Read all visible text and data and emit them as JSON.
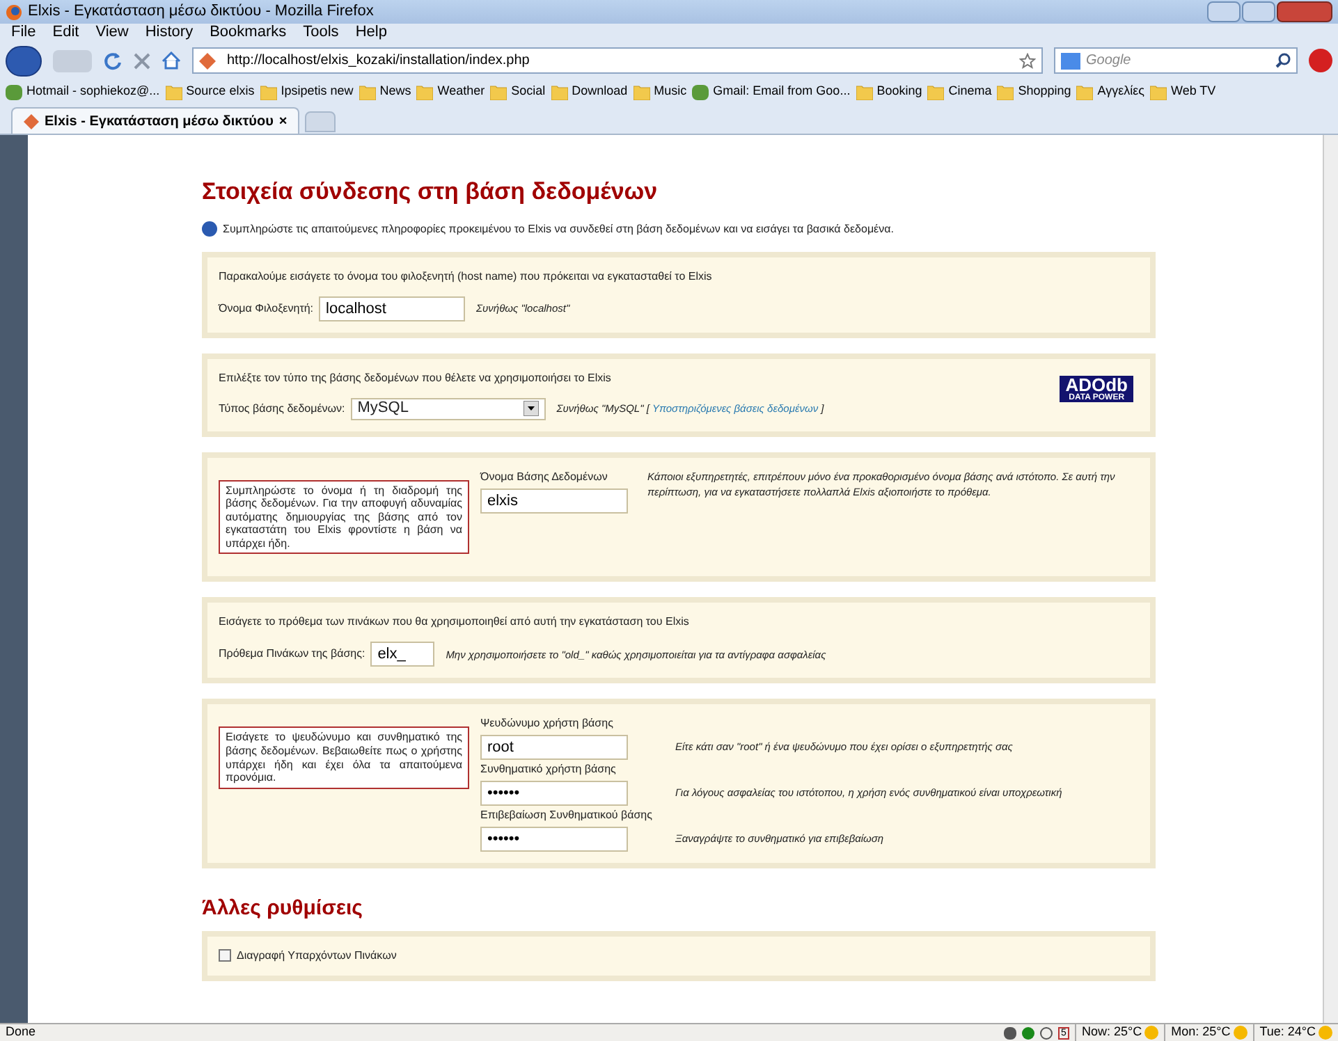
{
  "window": {
    "title": "Elxis - Εγκατάσταση μέσω δικτύου - Mozilla Firefox"
  },
  "menu": [
    "File",
    "Edit",
    "View",
    "History",
    "Bookmarks",
    "Tools",
    "Help"
  ],
  "address": {
    "url": "http://localhost/elxis_kozaki/installation/index.php"
  },
  "search": {
    "placeholder": "Google"
  },
  "bookmarks": [
    {
      "label": "Hotmail - sophiekoz@...",
      "kind": "site"
    },
    {
      "label": "Source elxis",
      "kind": "folder"
    },
    {
      "label": "Ipsipetis new",
      "kind": "folder"
    },
    {
      "label": "News",
      "kind": "folder"
    },
    {
      "label": "Weather",
      "kind": "folder"
    },
    {
      "label": "Social",
      "kind": "folder"
    },
    {
      "label": "Download",
      "kind": "folder"
    },
    {
      "label": "Music",
      "kind": "folder"
    },
    {
      "label": "Gmail: Email from Goo...",
      "kind": "site"
    },
    {
      "label": "Booking",
      "kind": "folder"
    },
    {
      "label": "Cinema",
      "kind": "folder"
    },
    {
      "label": "Shopping",
      "kind": "folder"
    },
    {
      "label": "Αγγελίες",
      "kind": "folder"
    },
    {
      "label": "Web TV",
      "kind": "folder"
    }
  ],
  "tabs": [
    {
      "label": "Elxis - Εγκατάσταση μέσω δικτύου",
      "close": "×",
      "selected": true
    }
  ],
  "page": {
    "heading": "Στοιχεία σύνδεσης στη βάση δεδομένων",
    "info": "Συμπληρώστε τις απαιτούμενες πληροφορίες προκειμένου το Elxis να συνδεθεί στη βάση δεδομένων και να εισάγει τα βασικά δεδομένα.",
    "host": {
      "intro": "Παρακαλούμε εισάγετε το όνομα του φιλοξενητή (host name) που πρόκειται να εγκατασταθεί το Elxis",
      "label": "Όνομα Φιλοξενητή:",
      "value": "localhost",
      "hint": "Συνήθως \"localhost\""
    },
    "dbtype": {
      "intro": "Επιλέξτε τον τύπο της βάσης δεδομένων που θέλετε να χρησιμοποιήσει το Elxis",
      "label": "Τύπος βάσης δεδομένων:",
      "value": "MySQL",
      "hint": "Συνήθως \"MySQL\" [",
      "link": "Υποστηριζόμενες βάσεις δεδομένων",
      "hint_end": "]",
      "logo_top": "ADOdb",
      "logo_bottom": "DATA POWER"
    },
    "dbname": {
      "note": "Συμπληρώστε το όνομα ή τη διαδρομή της βάσης δεδομένων. Για την αποφυγή αδυναμίας αυτόματης δημιουργίας της βάσης από τον εγκαταστάτη του Elxis φροντίστε η βάση να υπάρχει ήδη.",
      "label": "Όνομα Βάσης Δεδομένων",
      "value": "elxis",
      "hint": "Κάποιοι εξυπηρετητές, επιτρέπουν μόνο ένα προκαθορισμένο όνομα βάσης ανά ιστότοπο. Σε αυτή την περίπτωση, για να εγκαταστήσετε πολλαπλά Elxis αξιοποιήστε το πρόθεμα."
    },
    "prefix": {
      "intro": "Εισάγετε το πρόθεμα των πινάκων που θα χρησιμοποιηθεί από αυτή την εγκατάσταση του Elxis",
      "label": "Πρόθεμα Πινάκων της βάσης:",
      "value": "elx_",
      "hint": "Μην χρησιμοποιήσετε το \"old_\" καθώς χρησιμοποιείται για τα αντίγραφα ασφαλείας"
    },
    "user": {
      "note": "Εισάγετε το ψευδώνυμο και συνθηματικό της βάσης δεδομένων. Βεβαιωθείτε πως ο χρήστης υπάρχει ήδη και έχει όλα τα απαιτούμενα προνόμια.",
      "fields": [
        {
          "label": "Ψευδώνυμο χρήστη βάσης",
          "value": "root",
          "hint": "Είτε κάτι σαν \"root\" ή ένα ψευδώνυμο που έχει ορίσει ο εξυπηρετητής σας"
        },
        {
          "label": "Συνθηματικό χρήστη βάσης",
          "value": "••••••",
          "hint": "Για λόγους ασφαλείας του ιστότοπου, η χρήση ενός συνθηματικού είναι υποχρεωτική"
        },
        {
          "label": "Επιβεβαίωση Συνθηματικού βάσης",
          "value": "••••••",
          "hint": "Ξαναγράψτε το συνθηματικό για επιβεβαίωση"
        }
      ]
    },
    "other_heading": "Άλλες ρυθμίσεις",
    "options": [
      {
        "label": "Διαγραφή Υπαρχόντων Πινάκων",
        "checked": false
      }
    ]
  },
  "status_bar": {
    "text": "Done",
    "calendar": "5",
    "weather": [
      "Now: 25°C",
      "Mon: 25°C",
      "Tue: 24°C"
    ]
  }
}
